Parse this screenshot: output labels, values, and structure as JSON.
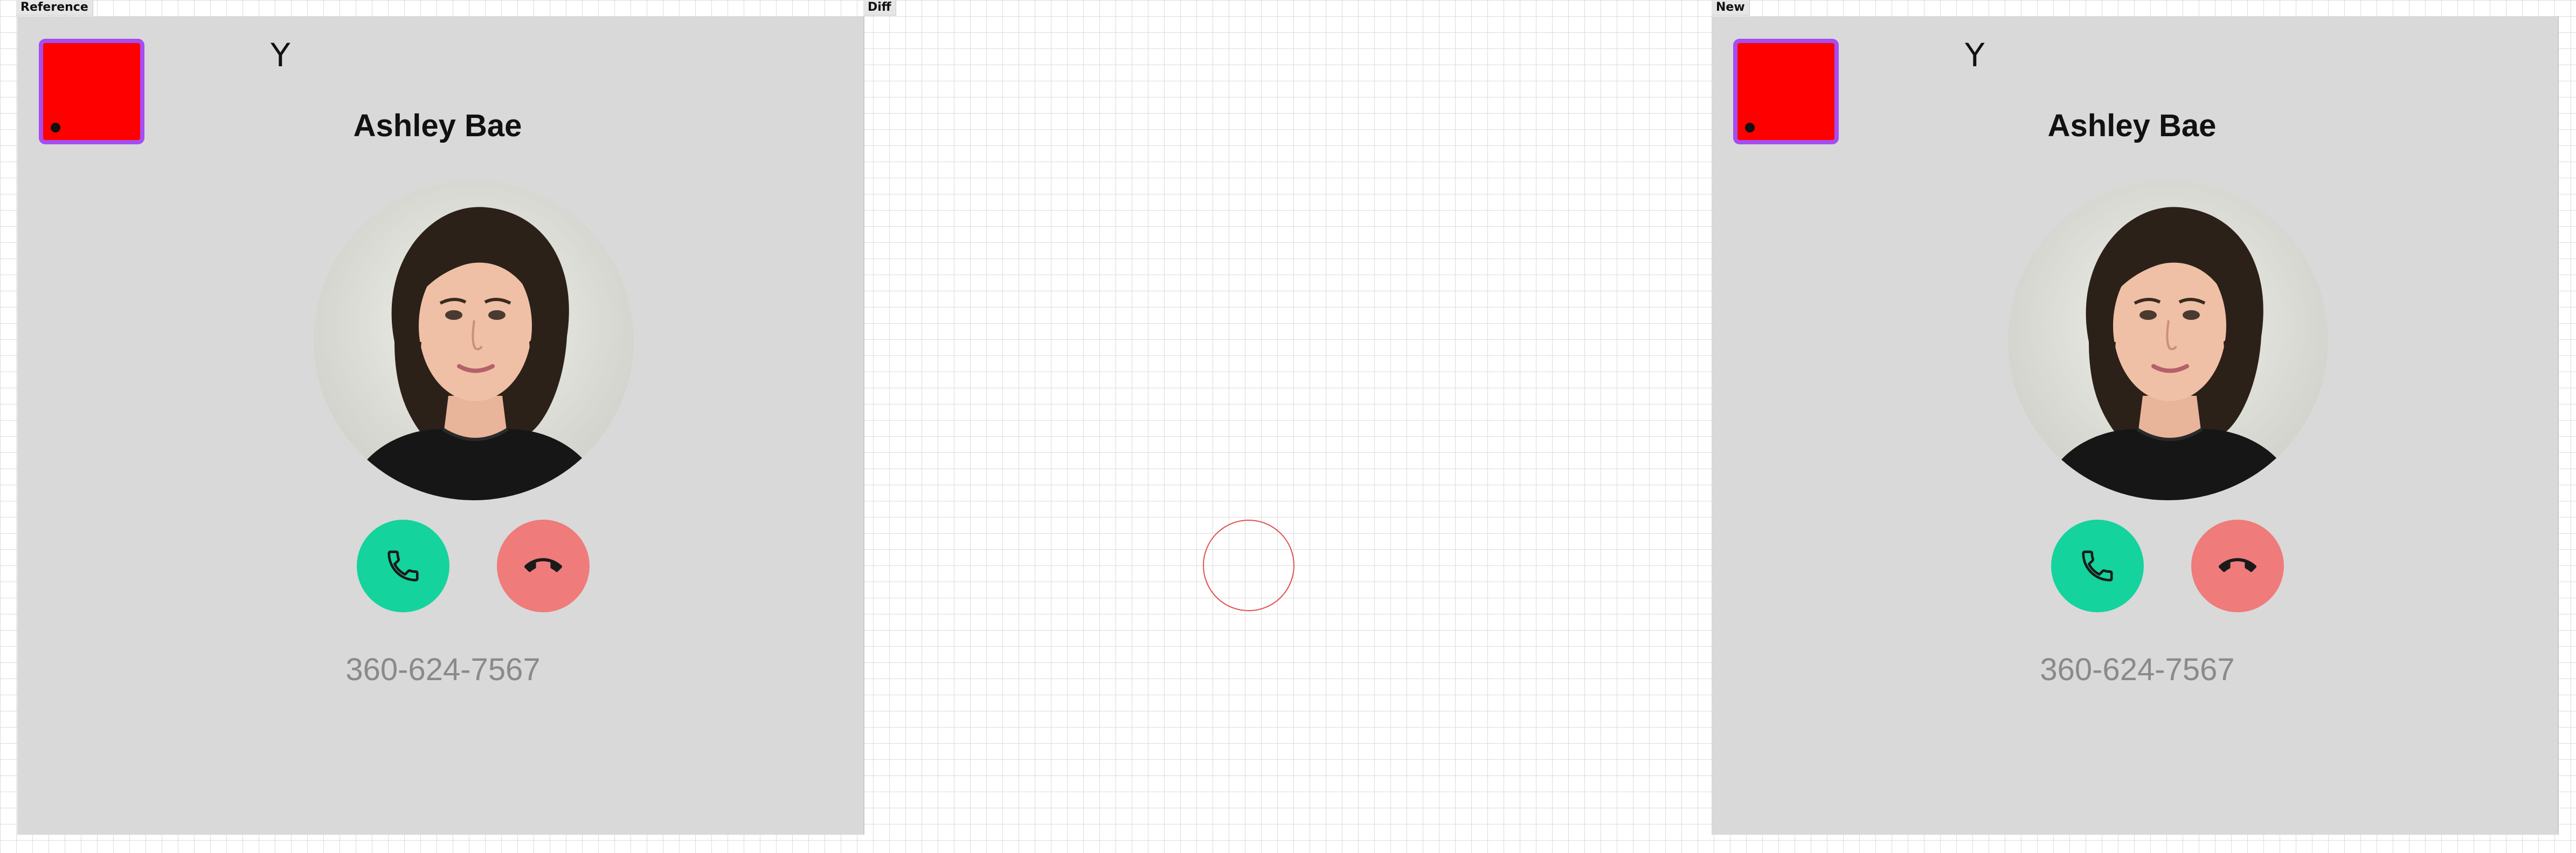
{
  "panels": {
    "reference_label": "Reference",
    "diff_label": "Diff",
    "new_label": "New"
  },
  "call_screen": {
    "corner_glyph": "Y",
    "contact_name": "Ashley Bae",
    "phone_number": "360-624-7567",
    "avatar_icon": "contact-photo",
    "accept_icon": "phone-icon",
    "decline_icon": "hang-up-icon"
  },
  "colors": {
    "screen_background": "#d9d9d9",
    "marker_fill": "#ff0000",
    "marker_border": "#a64cf0",
    "accept_button": "#14d39c",
    "decline_button": "#ef7b7b",
    "phone_number_text": "#8a8a8a",
    "diff_highlight": "#e05050"
  }
}
